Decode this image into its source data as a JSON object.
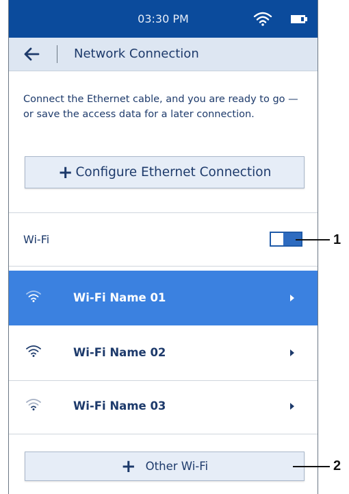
{
  "status_bar": {
    "time": "03:30 PM"
  },
  "header": {
    "title": "Network Connection"
  },
  "intro_text": "Connect the Ethernet cable, and you are ready to go — or save the access data for a later connection.",
  "ethernet_button": {
    "label": "Configure Ethernet Connection"
  },
  "wifi": {
    "label": "Wi-Fi",
    "enabled": true
  },
  "networks": [
    {
      "name": "Wi-Fi Name 01",
      "selected": true
    },
    {
      "name": "Wi-Fi Name 02",
      "selected": false
    },
    {
      "name": "Wi-Fi Name 03",
      "selected": false
    }
  ],
  "other_wifi_button": {
    "label": "Other Wi-Fi"
  },
  "callouts": [
    "1",
    "2"
  ],
  "colors": {
    "status_bar": "#0b4b9c",
    "header_bg": "#dde6f2",
    "selected_row": "#3b81e0",
    "text": "#1d3a6b"
  }
}
